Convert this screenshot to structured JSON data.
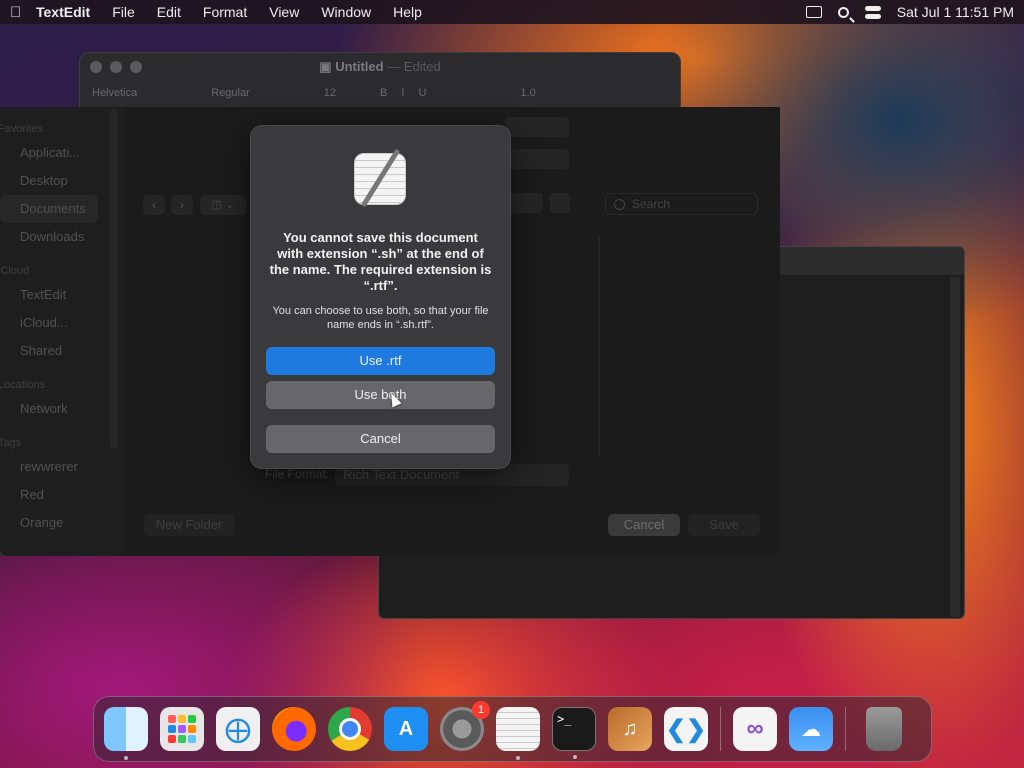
{
  "menubar": {
    "app_name": "TextEdit",
    "items": [
      "File",
      "Edit",
      "Format",
      "View",
      "Window",
      "Help"
    ],
    "clock": "Sat Jul 1  11:51 PM"
  },
  "textedit_window": {
    "title": "Untitled",
    "title_suffix": "— Edited",
    "toolbar": {
      "font": "Helvetica",
      "style": "Regular",
      "size": "12",
      "bold": "B",
      "italic": "I",
      "underline": "U",
      "spacing": "1.0"
    }
  },
  "save_sheet": {
    "sidebar": {
      "favorites_label": "Favorites",
      "favorites": [
        "Applicati...",
        "Desktop",
        "Documents",
        "Downloads"
      ],
      "icloud_label": "iCloud",
      "icloud": [
        "TextEdit",
        "iCloud...",
        "Shared"
      ],
      "locations_label": "Locations",
      "locations": [
        "Network"
      ],
      "tags_label": "Tags",
      "tags": [
        "rewwrerer",
        "Red",
        "Orange"
      ]
    },
    "search_placeholder": "Search",
    "file_format_label": "File Format:",
    "file_format_value": "Rich Text Document",
    "new_folder_label": "New Folder",
    "cancel_label": "Cancel",
    "save_label": "Save"
  },
  "alert": {
    "title": "You cannot save this document with extension “.sh” at the end of the name. The required extension is “.rtf”.",
    "message": "You can choose to use both, so that your file name ends in “.sh.rtf”.",
    "primary_button": "Use .rtf",
    "secondary_button": "Use both",
    "cancel_button": "Cancel"
  },
  "dock": {
    "settings_badge": "1"
  },
  "colors": {
    "accent": "#1f7ae0",
    "dialog_bg": "#3a3a3c",
    "badge": "#ff3b30"
  },
  "icons": {
    "apple": "apple-icon",
    "search": "search-icon",
    "control_center": "control-center-icon",
    "textedit_app": "textedit-document-icon"
  }
}
